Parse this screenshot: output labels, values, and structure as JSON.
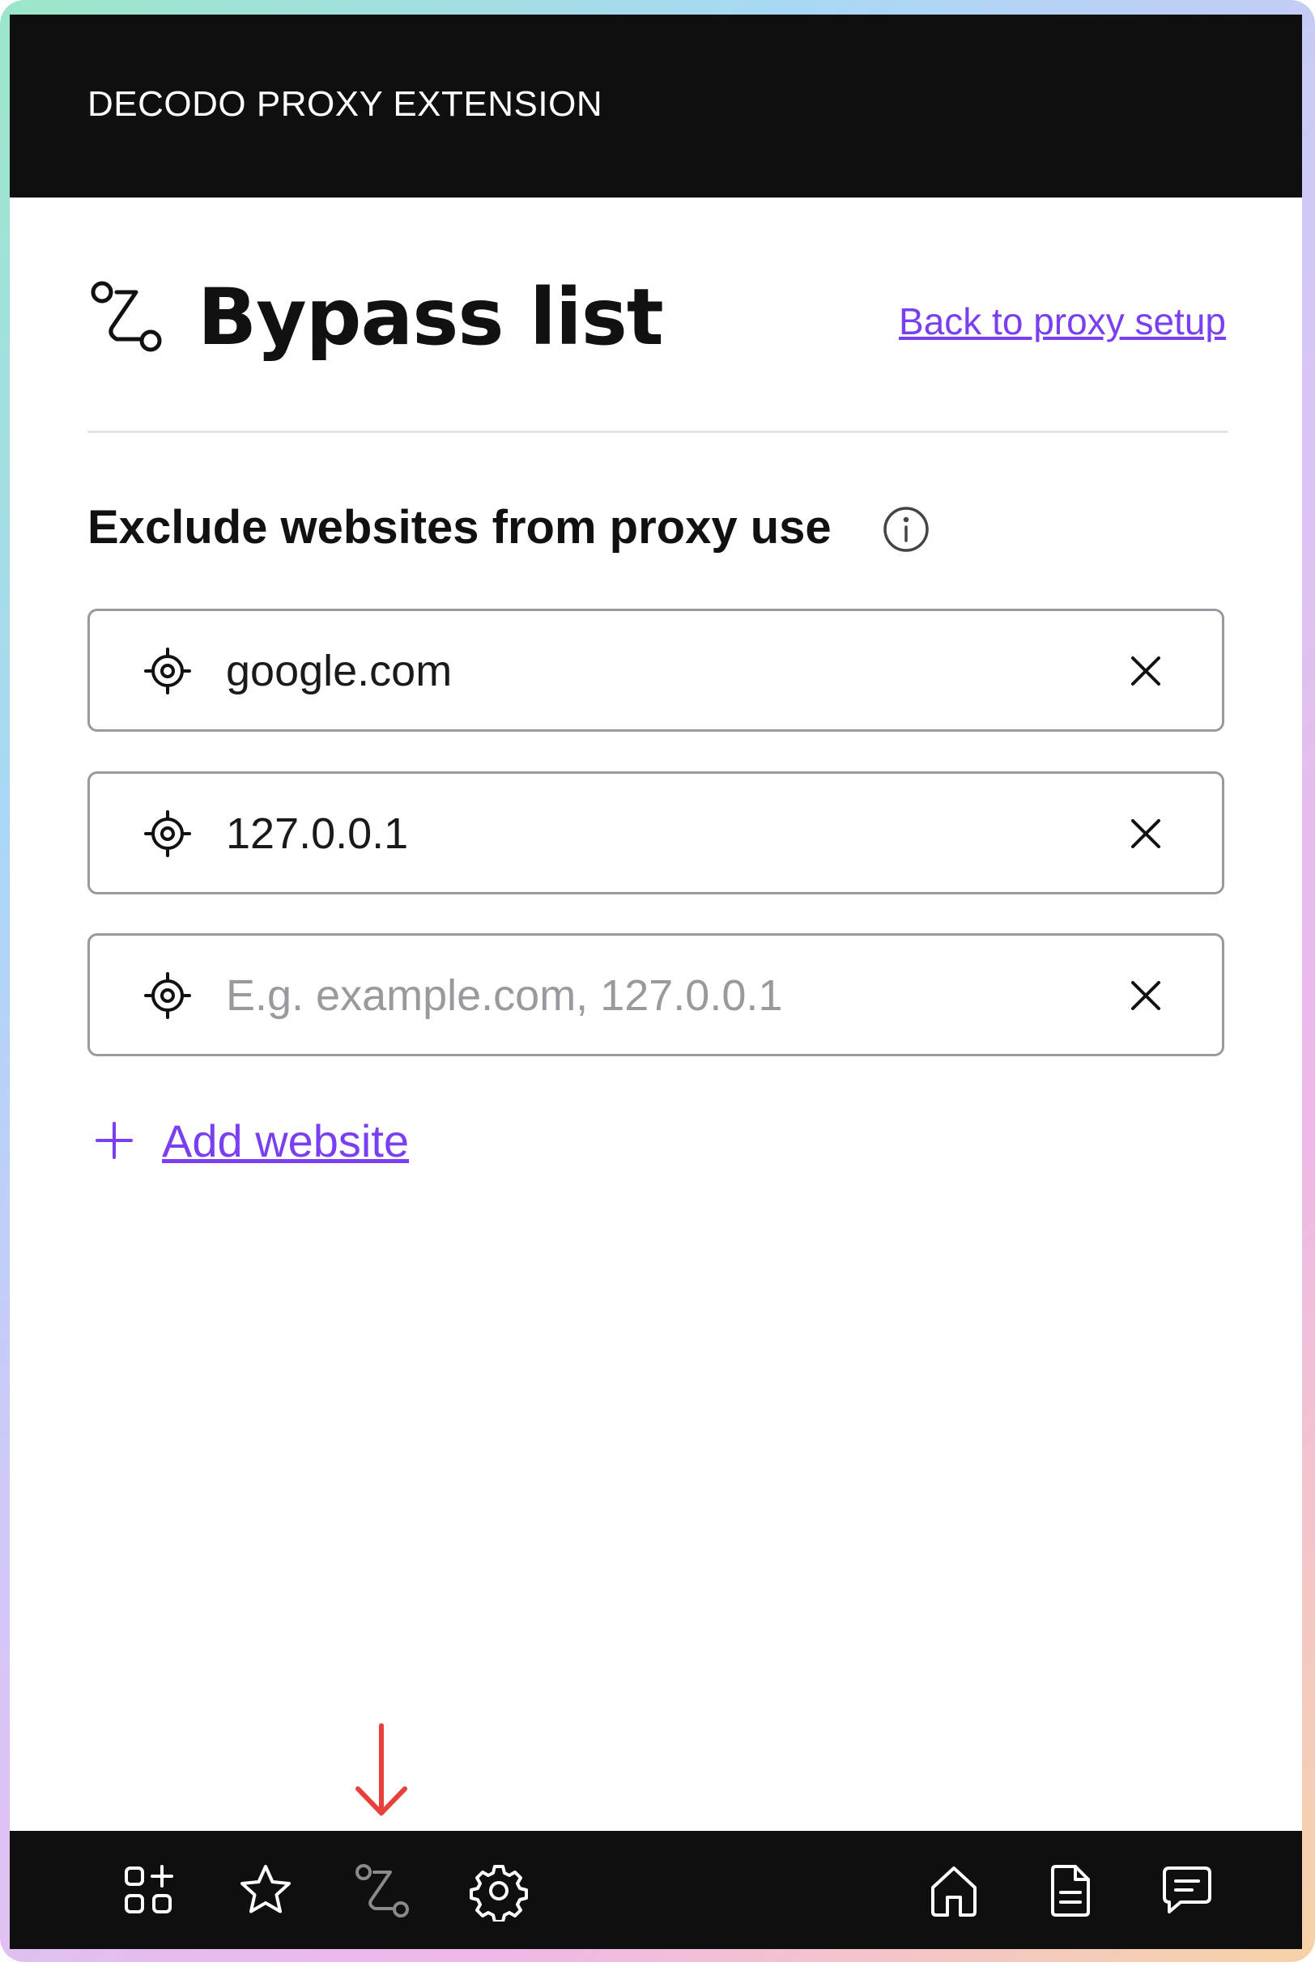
{
  "header": {
    "title": "DECODO PROXY EXTENSION"
  },
  "page": {
    "title": "Bypass list",
    "back_link": "Back to proxy setup"
  },
  "section": {
    "title": "Exclude websites from proxy use"
  },
  "entries": [
    {
      "value": "google.com"
    },
    {
      "value": "127.0.0.1"
    },
    {
      "value": "",
      "placeholder": "E.g. example.com, 127.0.0.1"
    }
  ],
  "add_website": {
    "label": "Add website"
  },
  "bottom_nav": {
    "left": [
      "add-widget-icon",
      "star-icon",
      "bypass-route-icon",
      "gear-icon"
    ],
    "right": [
      "home-icon",
      "document-icon",
      "chat-icon"
    ]
  },
  "colors": {
    "accent": "#7a3ff0",
    "bar_background": "#0f0f10",
    "arrow_indicator": "#e8403a",
    "inactive_nav": "#8a8a8e"
  }
}
